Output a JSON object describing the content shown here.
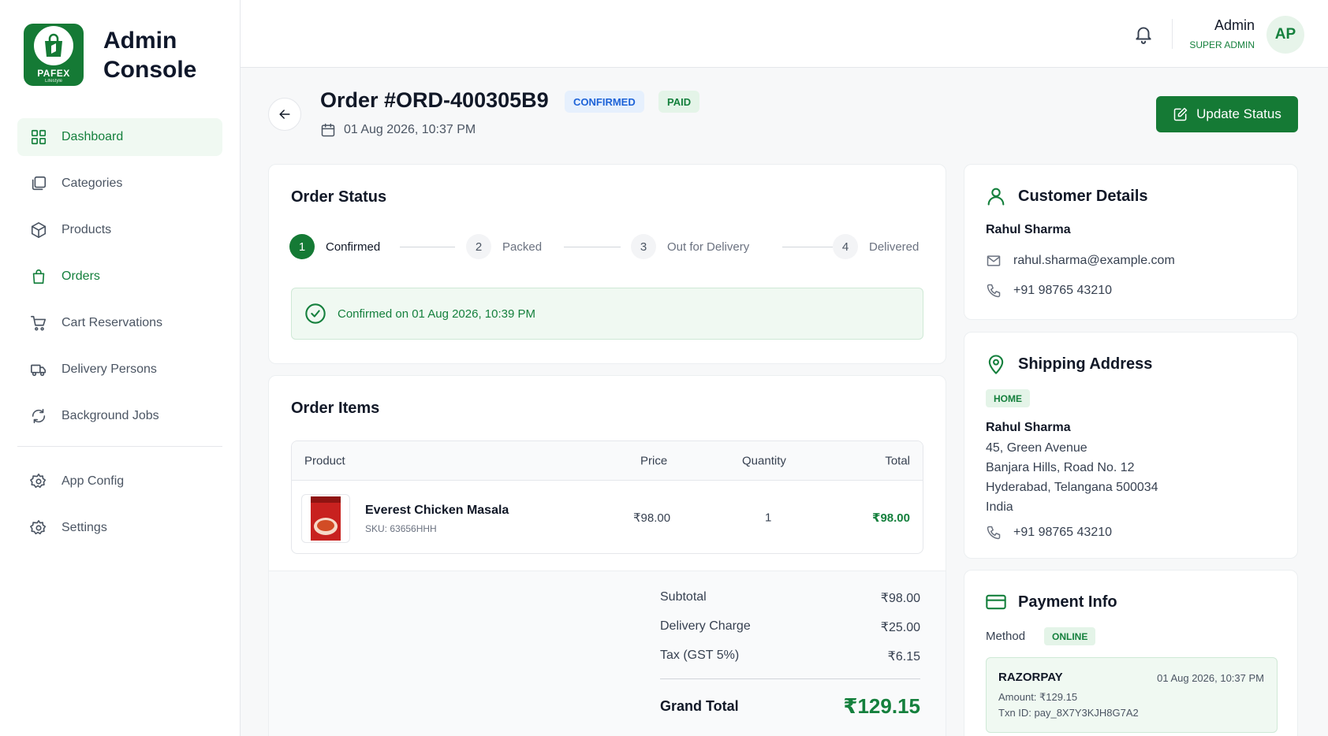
{
  "brand": {
    "logo_text": "PAFEX",
    "logo_sub": "Lifestyle",
    "title_line1": "Admin",
    "title_line2": "Console"
  },
  "sidebar": {
    "items": [
      {
        "label": "Dashboard",
        "icon": "grid-icon"
      },
      {
        "label": "Categories",
        "icon": "layers-icon"
      },
      {
        "label": "Products",
        "icon": "box-icon"
      },
      {
        "label": "Orders",
        "icon": "shopping-bag-icon"
      },
      {
        "label": "Cart Reservations",
        "icon": "cart-icon"
      },
      {
        "label": "Delivery Persons",
        "icon": "truck-icon"
      },
      {
        "label": "Background Jobs",
        "icon": "refresh-icon"
      }
    ],
    "bottom_items": [
      {
        "label": "App Config",
        "icon": "gear-icon"
      },
      {
        "label": "Settings",
        "icon": "gear-icon"
      }
    ]
  },
  "header": {
    "user_name": "Admin",
    "user_role": "SUPER ADMIN",
    "avatar_initials": "AP"
  },
  "order": {
    "title": "Order #ORD-400305B9",
    "status_badge": "CONFIRMED",
    "payment_badge": "PAID",
    "date": "01 Aug 2026, 10:37 PM",
    "update_label": "Update Status"
  },
  "status": {
    "title": "Order Status",
    "steps": [
      {
        "num": "1",
        "label": "Confirmed"
      },
      {
        "num": "2",
        "label": "Packed"
      },
      {
        "num": "3",
        "label": "Out for Delivery"
      },
      {
        "num": "4",
        "label": "Delivered"
      }
    ],
    "confirmed_message": "Confirmed on 01 Aug 2026, 10:39 PM"
  },
  "items": {
    "title": "Order Items",
    "headers": {
      "product": "Product",
      "price": "Price",
      "quantity": "Quantity",
      "total": "Total"
    },
    "rows": [
      {
        "name": "Everest Chicken Masala",
        "sku": "SKU: 63656HHH",
        "price": "₹98.00",
        "quantity": "1",
        "total": "₹98.00"
      }
    ],
    "totals": {
      "subtotal_label": "Subtotal",
      "subtotal": "₹98.00",
      "delivery_label": "Delivery Charge",
      "delivery": "₹25.00",
      "tax_label": "Tax (GST 5%)",
      "tax": "₹6.15",
      "grand_label": "Grand Total",
      "grand": "₹129.15"
    }
  },
  "customer": {
    "title": "Customer Details",
    "name": "Rahul Sharma",
    "email": "rahul.sharma@example.com",
    "phone": "+91 98765 43210"
  },
  "shipping": {
    "title": "Shipping Address",
    "tag": "HOME",
    "name": "Rahul Sharma",
    "line1": "45, Green Avenue",
    "line2": "Banjara Hills, Road No. 12",
    "line3": "Hyderabad, Telangana 500034",
    "line4": "India",
    "phone": "+91 98765 43210"
  },
  "payment": {
    "title": "Payment Info",
    "method_label": "Method",
    "method": "ONLINE",
    "gateway": "RAZORPAY",
    "date": "01 Aug 2026, 10:37 PM",
    "amount": "Amount: ₹129.15",
    "txn": "Txn ID: pay_8X7Y3KJH8G7A2"
  },
  "colors": {
    "brand_green": "#157a35",
    "accent_green": "#15803d",
    "confirmed_blue": "#1d63d8"
  }
}
